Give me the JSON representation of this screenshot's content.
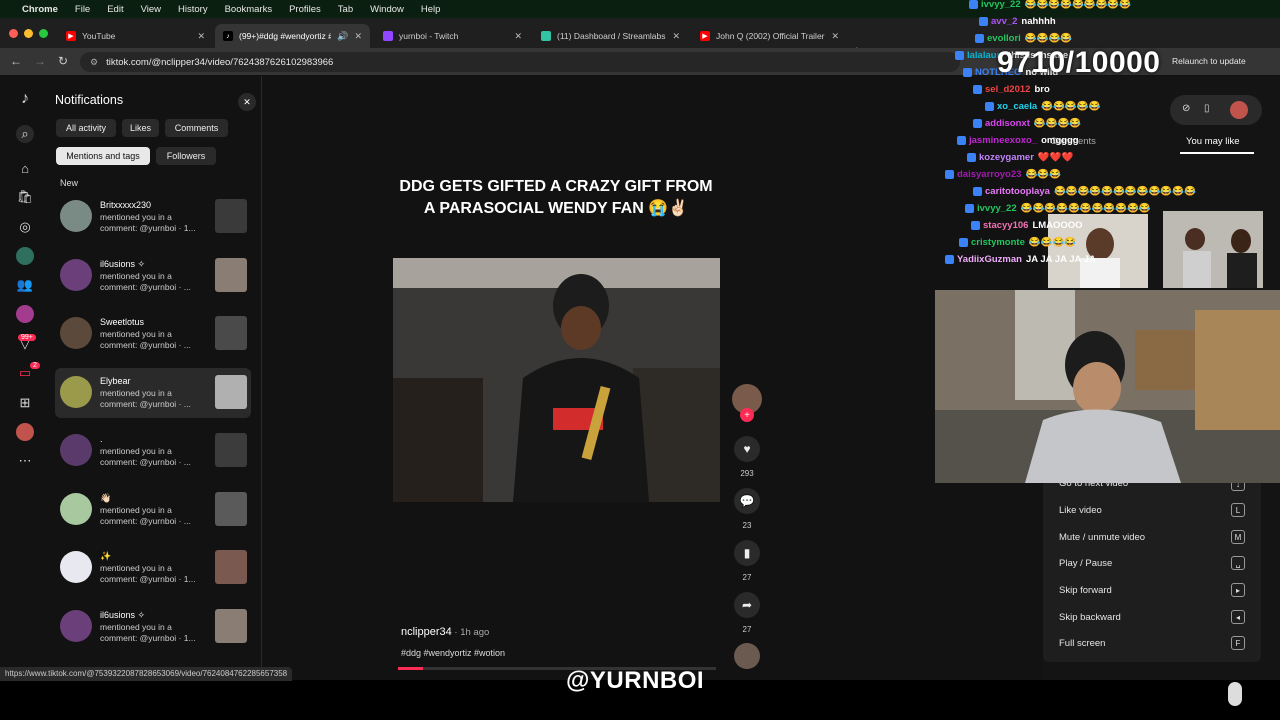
{
  "menubar": {
    "app": "Chrome",
    "items": [
      "File",
      "Edit",
      "View",
      "History",
      "Bookmarks",
      "Profiles",
      "Tab",
      "Window",
      "Help"
    ]
  },
  "tabs": [
    {
      "title": "YouTube",
      "icon": "youtube-icon"
    },
    {
      "title": "(99+)#ddg #wendyortiz #",
      "icon": "tiktok-icon"
    },
    {
      "title": "yurnboi - Twitch",
      "icon": "twitch-icon"
    },
    {
      "title": "(11) Dashboard / Streamlabs",
      "icon": "streamlabs-icon"
    },
    {
      "title": "John Q (2002) Official Trailer",
      "icon": "youtube-icon"
    }
  ],
  "address": {
    "url": "tiktok.com/@nclipper34/video/7624387626102983966",
    "relaunch": "Relaunch to update"
  },
  "notifications": {
    "title": "Notifications",
    "filters": [
      "All activity",
      "Likes",
      "Comments",
      "Mentions and tags",
      "Followers"
    ],
    "section": "New",
    "items": [
      {
        "name": "Britxxxxx230",
        "line1": "mentioned you in a",
        "line2": "comment: @yurnboi · 1..."
      },
      {
        "name": "il6usions ✧",
        "line1": "mentioned you in a",
        "line2": "comment: @yurnboi · ..."
      },
      {
        "name": "Sweetlotus",
        "line1": "mentioned you in a",
        "line2": "comment: @yurnboi · ..."
      },
      {
        "name": "Elybear",
        "line1": "mentioned you in a",
        "line2": "comment: @yurnboi · ..."
      },
      {
        "name": ".",
        "line1": "mentioned you in a",
        "line2": "comment: @yurnboi · ..."
      },
      {
        "name": "👋🏻",
        "line1": "mentioned you in a",
        "line2": "comment: @yurnboi · ..."
      },
      {
        "name": "✨",
        "line1": "mentioned you in a",
        "line2": "comment: @yurnboi · 1..."
      },
      {
        "name": "il6usions ✧",
        "line1": "mentioned you in a",
        "line2": "comment: @yurnboi · 1..."
      }
    ],
    "rail_badges": {
      "inbox": "99+",
      "messages": "2"
    }
  },
  "video": {
    "caption": "DDG GETS GIFTED A CRAZY GIFT FROM A PARASOCIAL WENDY FAN 😭✌🏻",
    "author": "nclipper34",
    "ago": " · 1h ago",
    "hashtags": "#ddg #wendyortiz #wotion",
    "progress": 0.08,
    "counts": {
      "likes": "293",
      "comments": "23",
      "saves": "27",
      "shares": "27"
    }
  },
  "rightpanel": {
    "tab_comments": "Comments",
    "tab_like": "You may like",
    "shortcuts": [
      {
        "label": "Go to next video",
        "key": "↓"
      },
      {
        "label": "Like video",
        "key": "L"
      },
      {
        "label": "Mute / unmute video",
        "key": "M"
      },
      {
        "label": "Play / Pause",
        "key": "␣"
      },
      {
        "label": "Skip forward",
        "key": "▸"
      },
      {
        "label": "Skip backward",
        "key": "◂"
      },
      {
        "label": "Full screen",
        "key": "F"
      }
    ]
  },
  "overlay": {
    "counter": "9710/10000",
    "watermark": "@YURNBOI",
    "chat": [
      {
        "user": "ivvyy_22",
        "msg": "😂😂😂😂😂😂😂😂😂",
        "color": "#22c55e"
      },
      {
        "user": "avv_2",
        "msg": "nahhhh",
        "color": "#a855f7"
      },
      {
        "user": "evollori",
        "msg": "😂😂😂😂",
        "color": "#22c55e"
      },
      {
        "user": "lalalaurr",
        "msg": "this is insane",
        "color": "#06b6d4"
      },
      {
        "user": "NOTLHEO",
        "msg": "no wild",
        "color": "#3b82f6"
      },
      {
        "user": "sel_d2012",
        "msg": "bro",
        "color": "#ef4444"
      },
      {
        "user": "xo_caela",
        "msg": "😂😂😂😂😂",
        "color": "#22d3ee"
      },
      {
        "user": "addisonxt",
        "msg": "😂😂😂😂",
        "color": "#d946ef"
      },
      {
        "user": "jasmineexoxo_",
        "msg": "omgggg",
        "color": "#c026d3"
      },
      {
        "user": "kozeygamer",
        "msg": "❤️❤️❤️",
        "color": "#c084fc"
      },
      {
        "user": "daisyarroyo23",
        "msg": "😂😂😂",
        "color": "#a21caf"
      },
      {
        "user": "caritotooplaya",
        "msg": "😂😂😂😂😂😂😂😂😂😂😂😂",
        "color": "#e879f9"
      },
      {
        "user": "ivvyy_22",
        "msg": "😂😂😂😂😂😂😂😂😂😂😂",
        "color": "#22c55e"
      },
      {
        "user": "stacyy106",
        "msg": "LMAOOOO",
        "color": "#f472b6"
      },
      {
        "user": "cristymonte",
        "msg": "😂😂😂😂",
        "color": "#22c55e"
      },
      {
        "user": "YadiixGuzman",
        "msg": "JA JA JA JA JA",
        "color": "#f0abfc"
      }
    ]
  },
  "status_url": "https://www.tiktok.com/@7539322087828653069/video/7624084762285657358",
  "colors": {
    "accent": "#fe2c55",
    "bg": "#121212"
  }
}
